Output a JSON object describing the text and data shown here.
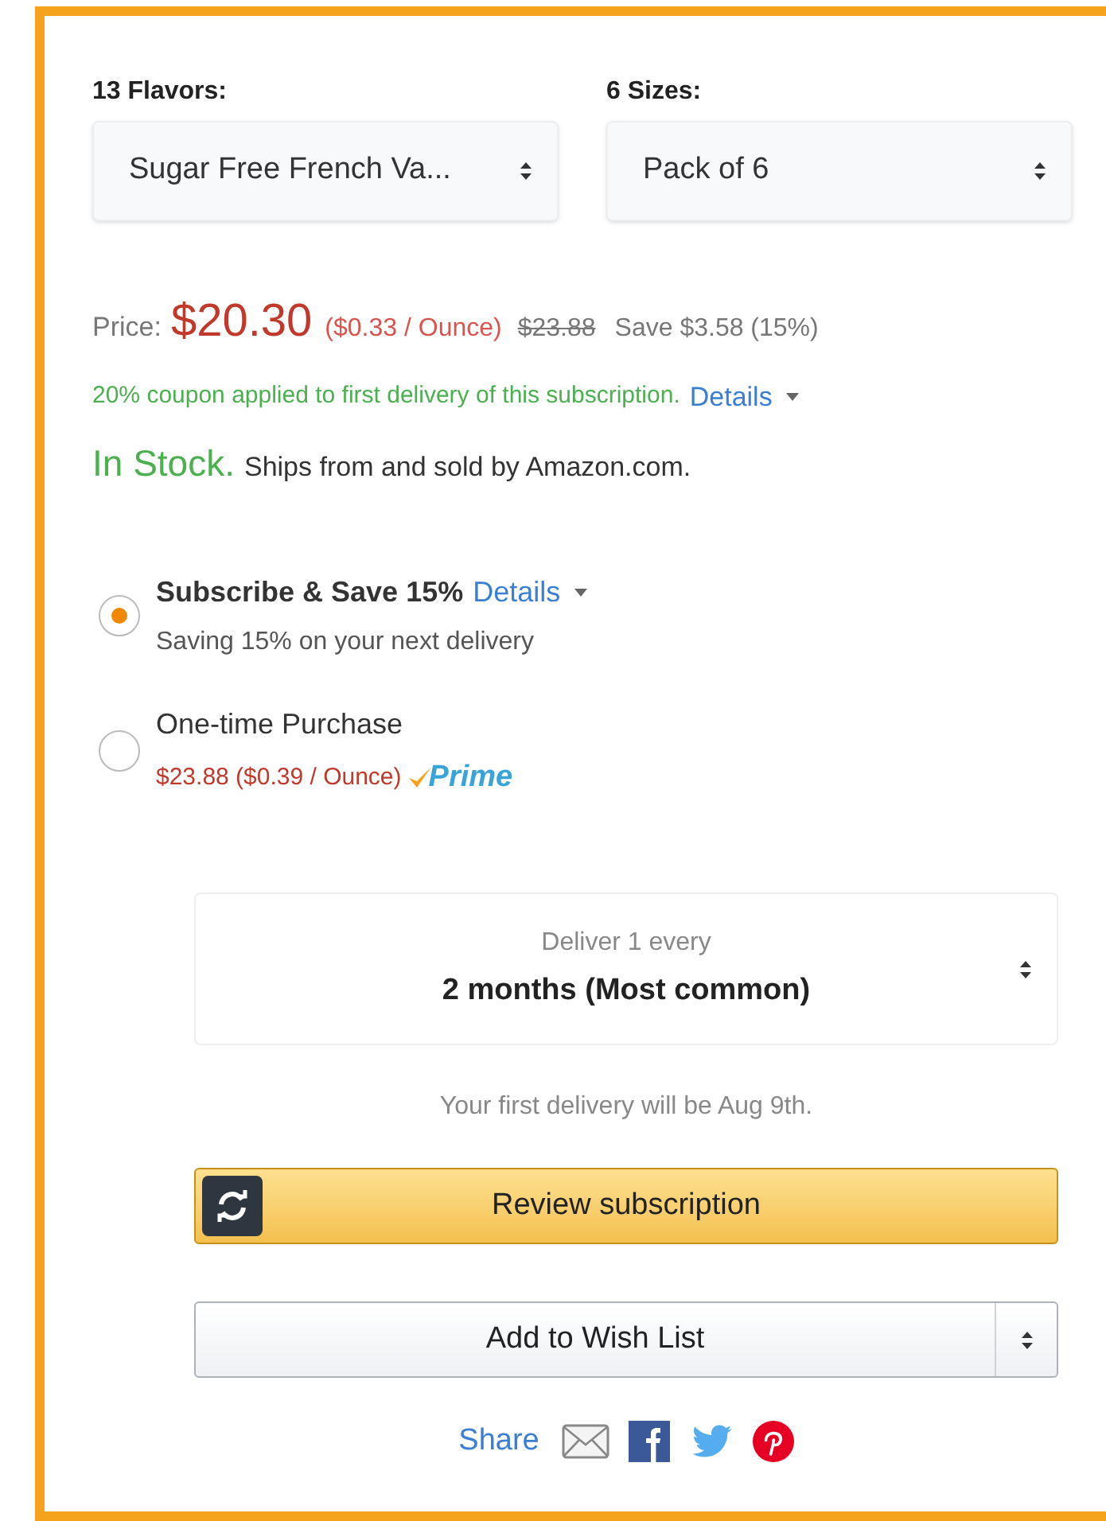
{
  "variations": [
    {
      "label": "13 Flavors:",
      "value": "Sugar Free French Va..."
    },
    {
      "label": "6 Sizes:",
      "value": "Pack of 6"
    }
  ],
  "price": {
    "label": "Price:",
    "amount": "$20.30",
    "unit_price": "($0.33 / Ounce)",
    "list_price": "$23.88",
    "savings": "Save $3.58 (15%)"
  },
  "coupon": {
    "text": "20% coupon applied to first delivery of this subscription.",
    "link": "Details"
  },
  "availability": {
    "status": "In Stock.",
    "text": "Ships from and sold by Amazon.com."
  },
  "purchase_options": [
    {
      "kind": "subscribe",
      "selected": true,
      "title": "Subscribe & Save 15%",
      "link": "Details",
      "subtitle": "Saving 15% on your next delivery"
    },
    {
      "kind": "one_time",
      "selected": false,
      "title": "One-time Purchase",
      "subtitle": "$23.88 ($0.39 / Ounce)",
      "badge": "Prime"
    }
  ],
  "delivery": {
    "label": "Deliver 1 every",
    "value": "2 months (Most common)"
  },
  "first_delivery": "Your first delivery will be Aug 9th.",
  "review_button": "Review subscription",
  "wish_list_button": "Add to Wish List",
  "share": {
    "label": "Share"
  }
}
